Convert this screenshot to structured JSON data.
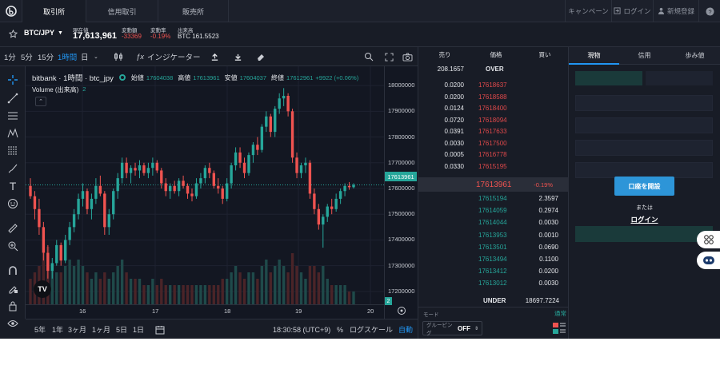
{
  "nav": {
    "tabs": [
      "取引所",
      "信用取引",
      "販売所"
    ],
    "campaign": "キャンペーン",
    "login": "ログイン",
    "register": "新規登録"
  },
  "ticker": {
    "pair": "BTC/JPY",
    "price_label": "現在値",
    "price": "17,613,961",
    "change_label": "変動額",
    "change": "-33369",
    "rate_label": "変動率",
    "rate": "-0.19%",
    "volume_label": "出来高",
    "volume": "BTC 161.5523"
  },
  "toolbar": {
    "intervals": [
      "1分",
      "5分",
      "15分",
      "1時間",
      "日"
    ],
    "active_interval": "1時間",
    "indicator": "インジケーター"
  },
  "chart": {
    "legend": {
      "title": "bitbank · 1時間 · btc_jpy",
      "open_label": "始値",
      "open": "17604038",
      "high_label": "高値",
      "high": "17613961",
      "low_label": "安値",
      "low": "17604037",
      "close_label": "終値",
      "close": "17612961",
      "change": "+9922 (+0.06%)"
    },
    "volume_label": "Volume (出来高)",
    "volume_value": "2",
    "volume_badge": "2",
    "last_price_tag": "17613961",
    "y_ticks": [
      "18000000",
      "17900000",
      "17800000",
      "17700000",
      "17600000",
      "17500000",
      "17400000",
      "17300000",
      "17200000"
    ],
    "x_ticks": [
      "16",
      "17",
      "18",
      "19",
      "20"
    ]
  },
  "chart_data": {
    "type": "candlestick",
    "series_name": "btc_jpy",
    "ylim": [
      17150000,
      18050000
    ],
    "x_ticks": [
      "16",
      "17",
      "18",
      "19",
      "20"
    ],
    "candles": [
      [
        17610000,
        17640000,
        17560000,
        17570000,
        4
      ],
      [
        17570000,
        17590000,
        17480000,
        17520000,
        5
      ],
      [
        17520000,
        17560000,
        17420000,
        17450000,
        6
      ],
      [
        17450000,
        17470000,
        17320000,
        17350000,
        8
      ],
      [
        17350000,
        17380000,
        17250000,
        17280000,
        9
      ],
      [
        17280000,
        17330000,
        17250000,
        17310000,
        6
      ],
      [
        17310000,
        17400000,
        17300000,
        17380000,
        5
      ],
      [
        17380000,
        17390000,
        17300000,
        17320000,
        5
      ],
      [
        17320000,
        17420000,
        17310000,
        17400000,
        6
      ],
      [
        17400000,
        17470000,
        17380000,
        17450000,
        7
      ],
      [
        17450000,
        17520000,
        17430000,
        17500000,
        6
      ],
      [
        17500000,
        17580000,
        17480000,
        17560000,
        7
      ],
      [
        17560000,
        17620000,
        17530000,
        17590000,
        6
      ],
      [
        17590000,
        17600000,
        17500000,
        17520000,
        5
      ],
      [
        17520000,
        17580000,
        17480000,
        17560000,
        4
      ],
      [
        17560000,
        17640000,
        17540000,
        17610000,
        5
      ],
      [
        17610000,
        17650000,
        17570000,
        17580000,
        4
      ],
      [
        17580000,
        17590000,
        17420000,
        17450000,
        5
      ],
      [
        17450000,
        17520000,
        17420000,
        17500000,
        4
      ],
      [
        17500000,
        17600000,
        17480000,
        17590000,
        5
      ],
      [
        17590000,
        17660000,
        17560000,
        17640000,
        6
      ],
      [
        17640000,
        17720000,
        17620000,
        17700000,
        7
      ],
      [
        17700000,
        17720000,
        17640000,
        17660000,
        5
      ],
      [
        17660000,
        17690000,
        17620000,
        17680000,
        4
      ],
      [
        17680000,
        17700000,
        17650000,
        17670000,
        4
      ],
      [
        17670000,
        17710000,
        17640000,
        17690000,
        4
      ],
      [
        17690000,
        17700000,
        17650000,
        17660000,
        3
      ],
      [
        17660000,
        17700000,
        17640000,
        17680000,
        3
      ],
      [
        17680000,
        17720000,
        17650000,
        17700000,
        4
      ],
      [
        17700000,
        17710000,
        17660000,
        17670000,
        3
      ],
      [
        17670000,
        17680000,
        17600000,
        17620000,
        4
      ],
      [
        17620000,
        17640000,
        17570000,
        17590000,
        3
      ],
      [
        17590000,
        17620000,
        17560000,
        17610000,
        3
      ],
      [
        17610000,
        17630000,
        17580000,
        17590000,
        3
      ],
      [
        17590000,
        17640000,
        17570000,
        17630000,
        3
      ],
      [
        17630000,
        17650000,
        17600000,
        17610000,
        3
      ],
      [
        17610000,
        17620000,
        17560000,
        17580000,
        3
      ],
      [
        17580000,
        17600000,
        17550000,
        17570000,
        3
      ],
      [
        17570000,
        17640000,
        17560000,
        17620000,
        3
      ],
      [
        17620000,
        17660000,
        17600000,
        17640000,
        3
      ],
      [
        17640000,
        17690000,
        17620000,
        17680000,
        3
      ],
      [
        17680000,
        17700000,
        17640000,
        17660000,
        3
      ],
      [
        17660000,
        17670000,
        17600000,
        17610000,
        3
      ],
      [
        17610000,
        17640000,
        17580000,
        17600000,
        3
      ],
      [
        17600000,
        17610000,
        17540000,
        17560000,
        4
      ],
      [
        17560000,
        17640000,
        17550000,
        17620000,
        4
      ],
      [
        17620000,
        17700000,
        17600000,
        17690000,
        5
      ],
      [
        17690000,
        17760000,
        17670000,
        17740000,
        6
      ],
      [
        17740000,
        17760000,
        17680000,
        17700000,
        5
      ],
      [
        17700000,
        17720000,
        17640000,
        17660000,
        4
      ],
      [
        17660000,
        17740000,
        17650000,
        17730000,
        5
      ],
      [
        17730000,
        17780000,
        17700000,
        17770000,
        5
      ],
      [
        17770000,
        17800000,
        17730000,
        17750000,
        4
      ],
      [
        17750000,
        17850000,
        17740000,
        17840000,
        6
      ],
      [
        17840000,
        17900000,
        17820000,
        17880000,
        7
      ],
      [
        17880000,
        17890000,
        17800000,
        17820000,
        5
      ],
      [
        17820000,
        17920000,
        17800000,
        17910000,
        6
      ],
      [
        17910000,
        17970000,
        17890000,
        17950000,
        7
      ],
      [
        17950000,
        17990000,
        17920000,
        17960000,
        6
      ],
      [
        17960000,
        17970000,
        17880000,
        17900000,
        5
      ],
      [
        17900000,
        17910000,
        17700000,
        17720000,
        8
      ],
      [
        17720000,
        17740000,
        17640000,
        17660000,
        6
      ],
      [
        17660000,
        17700000,
        17640000,
        17690000,
        5
      ],
      [
        17690000,
        17720000,
        17660000,
        17700000,
        4
      ],
      [
        17700000,
        17710000,
        17560000,
        17580000,
        6
      ],
      [
        17580000,
        17600000,
        17500000,
        17520000,
        6
      ],
      [
        17520000,
        17540000,
        17440000,
        17460000,
        5
      ],
      [
        17460000,
        17500000,
        17370000,
        17490000,
        6
      ],
      [
        17490000,
        17540000,
        17470000,
        17530000,
        4
      ],
      [
        17530000,
        17560000,
        17500000,
        17520000,
        3
      ],
      [
        17520000,
        17580000,
        17510000,
        17560000,
        3
      ],
      [
        17560000,
        17600000,
        17540000,
        17590000,
        3
      ],
      [
        17590000,
        17620000,
        17570000,
        17610000,
        3
      ],
      [
        17610000,
        17625000,
        17595000,
        17605000,
        2
      ],
      [
        17605000,
        17620000,
        17600000,
        17613961,
        2
      ]
    ]
  },
  "bottombar": {
    "ranges": [
      "5年",
      "1年",
      "3ヶ月",
      "1ヶ月",
      "5日",
      "1日"
    ],
    "time": "18:30:58 (UTC+9)",
    "percent": "%",
    "log": "ログスケール",
    "auto": "自動"
  },
  "orderbook": {
    "headers": {
      "sell": "売り",
      "price": "価格",
      "buy": "買い"
    },
    "over_label": "OVER",
    "over_value": "208.1657",
    "asks": [
      {
        "qty": "0.0200",
        "price": "17618637"
      },
      {
        "qty": "0.0200",
        "price": "17618588"
      },
      {
        "qty": "0.0124",
        "price": "17618400"
      },
      {
        "qty": "0.0720",
        "price": "17618094"
      },
      {
        "qty": "0.0391",
        "price": "17617633"
      },
      {
        "qty": "0.0030",
        "price": "17617500"
      },
      {
        "qty": "0.0005",
        "price": "17616778"
      },
      {
        "qty": "0.0330",
        "price": "17615195"
      }
    ],
    "mid_price": "17613961",
    "mid_change": "-0.19%",
    "bids": [
      {
        "price": "17615194",
        "qty": "2.3597"
      },
      {
        "price": "17614059",
        "qty": "0.2974"
      },
      {
        "price": "17614044",
        "qty": "0.0030"
      },
      {
        "price": "17613953",
        "qty": "0.0010"
      },
      {
        "price": "17613501",
        "qty": "0.0690"
      },
      {
        "price": "17613494",
        "qty": "0.1100"
      },
      {
        "price": "17613412",
        "qty": "0.0200"
      },
      {
        "price": "17613012",
        "qty": "0.0030"
      }
    ],
    "under_label": "UNDER",
    "under_value": "18697.7224",
    "mode_label": "モード",
    "mode_value": "通常",
    "grouping_label": "グルーピング",
    "grouping_value": "OFF"
  },
  "rightpanel": {
    "tabs": [
      "現物",
      "信用",
      "歩み値"
    ],
    "open_account": "口座を開設",
    "or": "または",
    "login": "ログイン"
  },
  "colors": {
    "up": "#26a69a",
    "down": "#ef5350",
    "accent": "#2196f3",
    "ask": "#e0494b",
    "bid": "#26a69a"
  }
}
